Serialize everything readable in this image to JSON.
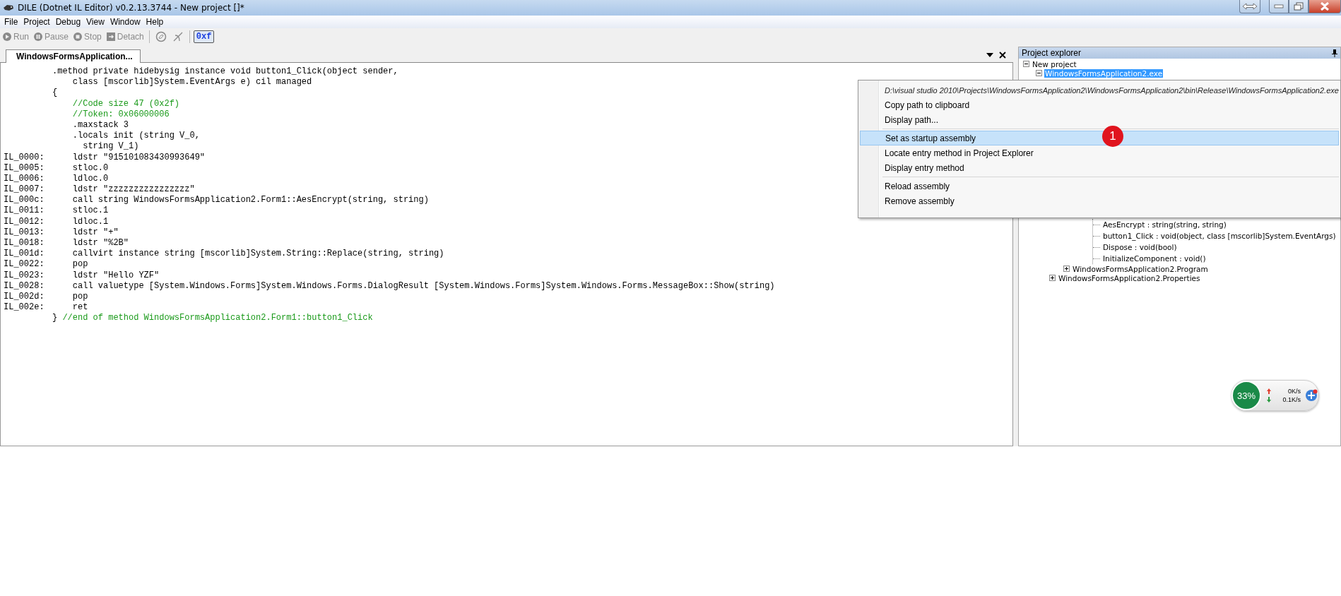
{
  "window": {
    "title": "DILE (Dotnet IL Editor) v0.2.13.3744 - New project []*"
  },
  "menu_bar": [
    "File",
    "Project",
    "Debug",
    "View",
    "Window",
    "Help"
  ],
  "toolbar": [
    {
      "kind": "button",
      "label": "Run",
      "disabled": true
    },
    {
      "kind": "button",
      "label": "Pause",
      "disabled": true
    },
    {
      "kind": "button",
      "label": "Stop",
      "disabled": true
    },
    {
      "kind": "button",
      "label": "Detach",
      "disabled": true
    },
    {
      "kind": "separator"
    },
    {
      "kind": "icon-button",
      "disabled": true
    },
    {
      "kind": "icon-button",
      "disabled": true
    },
    {
      "kind": "separator"
    },
    {
      "kind": "toggle",
      "label": "0xf",
      "on": true
    }
  ],
  "editor": {
    "tabs": [
      {
        "label": "WindowsFormsApplication...",
        "selected": true
      }
    ],
    "lines": [
      {
        "code": ".method private hidebysig instance void button1_Click(object sender,"
      },
      {
        "code": "    class [mscorlib]System.EventArgs e) cil managed"
      },
      {
        "code": "{"
      },
      {
        "comment": "    //Code size 47 (0x2f)"
      },
      {
        "comment": "    //Token: 0x06000006"
      },
      {
        "code": "    .maxstack 3"
      },
      {
        "code": "    .locals init (string V_0,"
      },
      {
        "code": "      string V_1)"
      },
      {
        "label": "IL_0000:",
        "code": "    ldstr \"915101083430993649\""
      },
      {
        "label": "IL_0005:",
        "code": "    stloc.0"
      },
      {
        "label": "IL_0006:",
        "code": "    ldloc.0"
      },
      {
        "label": "IL_0007:",
        "code": "    ldstr \"zzzzzzzzzzzzzzzz\""
      },
      {
        "label": "IL_000c:",
        "code": "    call string WindowsFormsApplication2.Form1::AesEncrypt(string, string)"
      },
      {
        "label": "IL_0011:",
        "code": "    stloc.1"
      },
      {
        "label": "IL_0012:",
        "code": "    ldloc.1"
      },
      {
        "label": "IL_0013:",
        "code": "    ldstr \"+\""
      },
      {
        "label": "IL_0018:",
        "code": "    ldstr \"%2B\""
      },
      {
        "label": "IL_001d:",
        "code": "    callvirt instance string [mscorlib]System.String::Replace(string, string)"
      },
      {
        "label": "IL_0022:",
        "code": "    pop"
      },
      {
        "label": "IL_0023:",
        "code": "    ldstr \"Hello YZF\""
      },
      {
        "label": "IL_0028:",
        "code": "    call valuetype [System.Windows.Forms]System.Windows.Forms.DialogResult [System.Windows.Forms]System.Windows.Forms.MessageBox::Show(string)"
      },
      {
        "label": "IL_002d:",
        "code": "    pop"
      },
      {
        "label": "IL_002e:",
        "code": "    ret"
      },
      {
        "code": "}",
        "comment": " //end of method WindowsFormsApplication2.Form1::button1_Click"
      }
    ]
  },
  "project_explorer": {
    "title": "Project explorer",
    "tree": [
      {
        "label": "New project",
        "expanded": true,
        "selected": false,
        "children": [
          {
            "label": "WindowsFormsApplication2.exe",
            "expanded": true,
            "selected": true
          }
        ]
      }
    ],
    "tree_continued": {
      "members": [
        "AesEncrypt : string(string, string)",
        "button1_Click : void(object, class [mscorlib]System.EventArgs)",
        "Dispose : void(bool)",
        "InitializeComponent : void()"
      ],
      "types": [
        {
          "label": "WindowsFormsApplication2.Program",
          "expanded": false
        }
      ],
      "namespaces": [
        {
          "label": "WindowsFormsApplication2.Properties",
          "expanded": false
        }
      ]
    }
  },
  "context_menu": {
    "path": "D:\\visual studio 2010\\Projects\\WindowsFormsApplication2\\WindowsFormsApplication2\\bin\\Release\\WindowsFormsApplication2.exe",
    "groups": [
      [
        {
          "label": "Copy path to clipboard",
          "selected": false
        },
        {
          "label": "Display path...",
          "selected": false
        }
      ],
      [
        {
          "label": "Set as startup assembly",
          "selected": true
        },
        {
          "label": "Locate entry method in Project Explorer",
          "selected": false
        },
        {
          "label": "Display entry method",
          "selected": false
        }
      ],
      [
        {
          "label": "Reload assembly",
          "selected": false
        },
        {
          "label": "Remove assembly",
          "selected": false
        }
      ]
    ]
  },
  "annotation_badge": "1",
  "speed_widget": {
    "percent": "33%",
    "upload": "0K/s",
    "download": "0.1K/s"
  }
}
